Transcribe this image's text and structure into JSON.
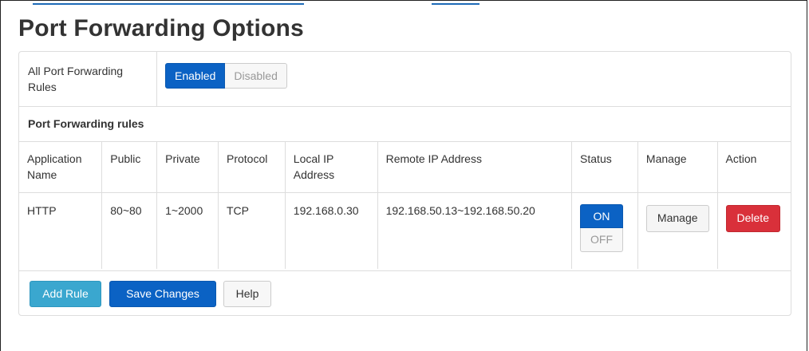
{
  "page": {
    "title": "Port Forwarding Options"
  },
  "global_toggle": {
    "label": "All Port Forwarding Rules",
    "enabled_label": "Enabled",
    "disabled_label": "Disabled",
    "selected": "Enabled"
  },
  "rules_section": {
    "title": "Port Forwarding rules"
  },
  "table": {
    "headers": [
      "Application Name",
      "Public",
      "Private",
      "Protocol",
      "Local IP Address",
      "Remote IP Address",
      "Status",
      "Manage",
      "Action"
    ],
    "rows": [
      {
        "app_name": "HTTP",
        "public": "80~80",
        "private": "1~2000",
        "protocol": "TCP",
        "local_ip": "192.168.0.30",
        "remote_ip": "192.168.50.13~192.168.50.20",
        "status_on": "ON",
        "status_off": "OFF",
        "manage_label": "Manage",
        "delete_label": "Delete"
      }
    ]
  },
  "footer": {
    "add_rule": "Add Rule",
    "save_changes": "Save Changes",
    "help": "Help"
  },
  "colors": {
    "primary": "#0b62c4",
    "info": "#3aa7cf",
    "danger": "#d9303a"
  }
}
